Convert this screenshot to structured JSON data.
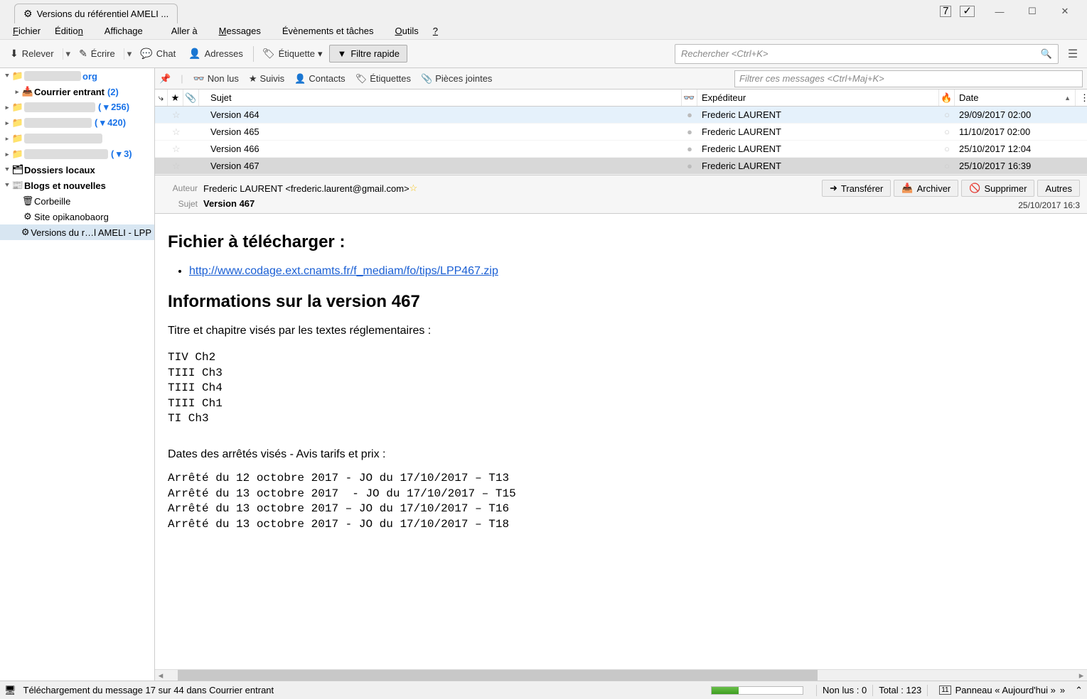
{
  "window": {
    "tab_title": "Versions du référentiel AMELI ..."
  },
  "menu": {
    "file": "Fichier",
    "edit": "Édition",
    "view": "Affichage",
    "go": "Aller à",
    "messages": "Messages",
    "events": "Évènements et tâches",
    "tools": "Outils",
    "help": "?"
  },
  "toolbar": {
    "relever": "Relever",
    "ecrire": "Écrire",
    "chat": "Chat",
    "adresses": "Adresses",
    "etiquette": "Étiquette",
    "filtre_rapide": "Filtre rapide",
    "search_placeholder": "Rechercher <Ctrl+K>"
  },
  "folders": {
    "acct1_suffix": "org",
    "inbox": "Courrier entrant",
    "inbox_count": "(2)",
    "acct2_count": "( ▾ 256)",
    "acct3_count": "( ▾ 420)",
    "acct5_count": "( ▾ 3)",
    "local": "Dossiers locaux",
    "blogs": "Blogs et nouvelles",
    "trash": "Corbeille",
    "site": "Site opikanobaorg",
    "versions": "Versions du r…l AMELI - LPP"
  },
  "filterbar": {
    "unread": "Non lus",
    "starred": "Suivis",
    "contacts": "Contacts",
    "tags": "Étiquettes",
    "attach": "Pièces jointes",
    "filter_placeholder": "Filtrer ces messages <Ctrl+Maj+K>"
  },
  "columns": {
    "subject": "Sujet",
    "sender": "Expéditeur",
    "date": "Date"
  },
  "messages": [
    {
      "subject": "Version 464",
      "sender": "Frederic LAURENT",
      "date": "29/09/2017 02:00",
      "selected": true
    },
    {
      "subject": "Version 465",
      "sender": "Frederic LAURENT",
      "date": "11/10/2017 02:00"
    },
    {
      "subject": "Version 466",
      "sender": "Frederic LAURENT",
      "date": "25/10/2017 12:04"
    },
    {
      "subject": "Version 467",
      "sender": "Frederic LAURENT",
      "date": "25/10/2017 16:39",
      "current": true
    }
  ],
  "message_header": {
    "author_label": "Auteur",
    "author_value": "Frederic LAURENT <frederic.laurent@gmail.com>",
    "subject_label": "Sujet",
    "subject_value": "Version 467",
    "transfer": "Transférer",
    "archive": "Archiver",
    "delete": "Supprimer",
    "more": "Autres",
    "datetime": "25/10/2017 16:3"
  },
  "body": {
    "h1": "Fichier à télécharger :",
    "link": "http://www.codage.ext.cnamts.fr/f_mediam/fo/tips/LPP467.zip",
    "h2": "Informations sur la version 467",
    "p1": "Titre et chapitre visés par les textes réglementaires :",
    "pre1": "TIV Ch2\nTIII Ch3\nTIII Ch4\nTIII Ch1\nTI Ch3",
    "p2": "Dates des arrêtés visés - Avis tarifs et prix :",
    "pre2": "Arrêté du 12 octobre 2017 - JO du 17/10/2017 – T13\nArrêté du 13 octobre 2017  - JO du 17/10/2017 – T15\nArrêté du 13 octobre 2017 – JO du 17/10/2017 – T16\nArrêté du 13 octobre 2017 - JO du 17/10/2017 – T18"
  },
  "status": {
    "download": "Téléchargement du message 17 sur 44 dans Courrier entrant",
    "unread": "Non lus : 0",
    "total": "Total : 123",
    "today_panel": "Panneau « Aujourd'hui »"
  }
}
